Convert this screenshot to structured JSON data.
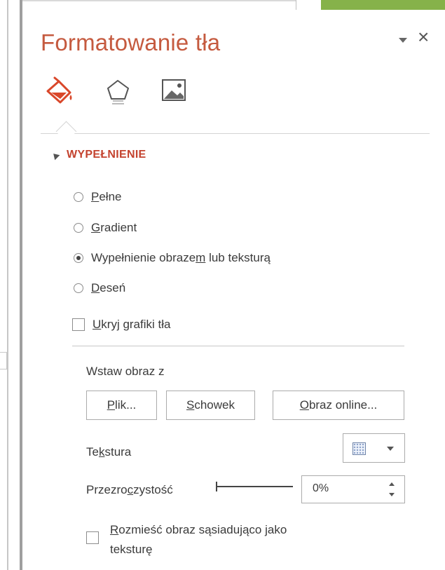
{
  "pane": {
    "title": "Formatowanie tła",
    "close_glyph": "×"
  },
  "icons": {
    "tab_fill": "paint-bucket-icon",
    "tab_effects": "pentagon-icon",
    "tab_picture": "image-icon"
  },
  "section": {
    "title": "WYPEŁNIENIE"
  },
  "fill_options": [
    {
      "pre": "",
      "key": "P",
      "post": "ełne",
      "checked": false
    },
    {
      "pre": "",
      "key": "G",
      "post": "radient",
      "checked": false
    },
    {
      "pre": "Wypełnienie obraze",
      "key": "m",
      "post": " lub teksturą",
      "checked": true
    },
    {
      "pre": "",
      "key": "D",
      "post": "eseń",
      "checked": false
    }
  ],
  "hide_graphics": {
    "key": "U",
    "rest": "kryj grafiki tła",
    "checked": false
  },
  "insert": {
    "label": "Wstaw obraz z",
    "file": {
      "key": "P",
      "rest": "lik..."
    },
    "clipboard": {
      "key": "S",
      "rest": "chowek"
    },
    "online": {
      "key": "O",
      "rest": "braz online..."
    }
  },
  "texture": {
    "pre": "Te",
    "key": "k",
    "post": "stura"
  },
  "transparency": {
    "pre": "Przezro",
    "key": "c",
    "post": "zystość",
    "value": "0%"
  },
  "tile": {
    "key": "R",
    "line1": "ozmieść obraz sąsiadująco jako",
    "line2": "teksturę",
    "checked": false
  },
  "colors": {
    "accent": "#c55a3f",
    "section_accent": "#c4432f"
  }
}
